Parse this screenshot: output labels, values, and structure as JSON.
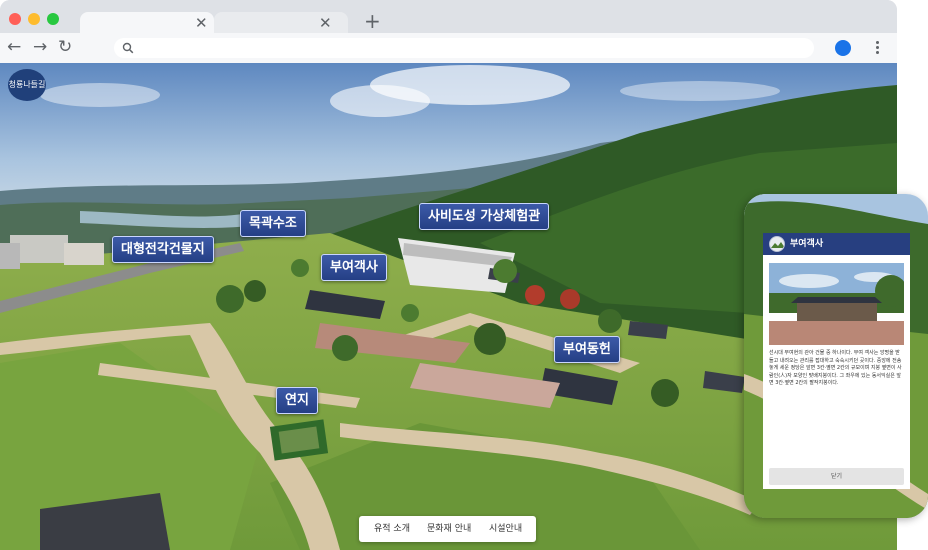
{
  "browser": {
    "tabs": [
      {
        "title": "",
        "close_label": "✕"
      },
      {
        "title": "",
        "close_label": "✕"
      }
    ],
    "new_tab_label": "+",
    "nav": {
      "back": "←",
      "forward": "→",
      "reload": "↻"
    },
    "address": {
      "value": "",
      "search_icon": "search-icon"
    }
  },
  "site": {
    "logo_text": "청룡나들길",
    "hotspots": [
      {
        "label": "목곽수조"
      },
      {
        "label": "사비도성 가상체험관"
      },
      {
        "label": "대형전각건물지"
      },
      {
        "label": "부여객사"
      },
      {
        "label": "부여동헌"
      },
      {
        "label": "연지"
      }
    ],
    "bottom_menu": {
      "items": [
        "유적 소개",
        "문화재 안내",
        "시설안내"
      ]
    }
  },
  "info_panel": {
    "title": "부여객사",
    "description": "선시대 부여현의 관아 건물 중 하나이다. 부여 객사는 앙명을 받들고 내려오는 관리를 접대하고 숙숙시키던 곳이다. 중앙에 전송 놓게 세운 정당은 앞면 3칸·옆면 2칸의 규모이며 지붕 옆면이 사람인(人)자 모양인 맞배지붕이다. 그 좌우에 있는 동서익실은 앞면 3칸·옆면 2칸의 팔작지붕이다.",
    "close_label": "닫기"
  },
  "colors": {
    "hotspot_bg": "#2f4d9b",
    "panel_header": "#273f80",
    "browser_chrome": "#dee1e6",
    "profile_accent": "#1a73e8"
  }
}
